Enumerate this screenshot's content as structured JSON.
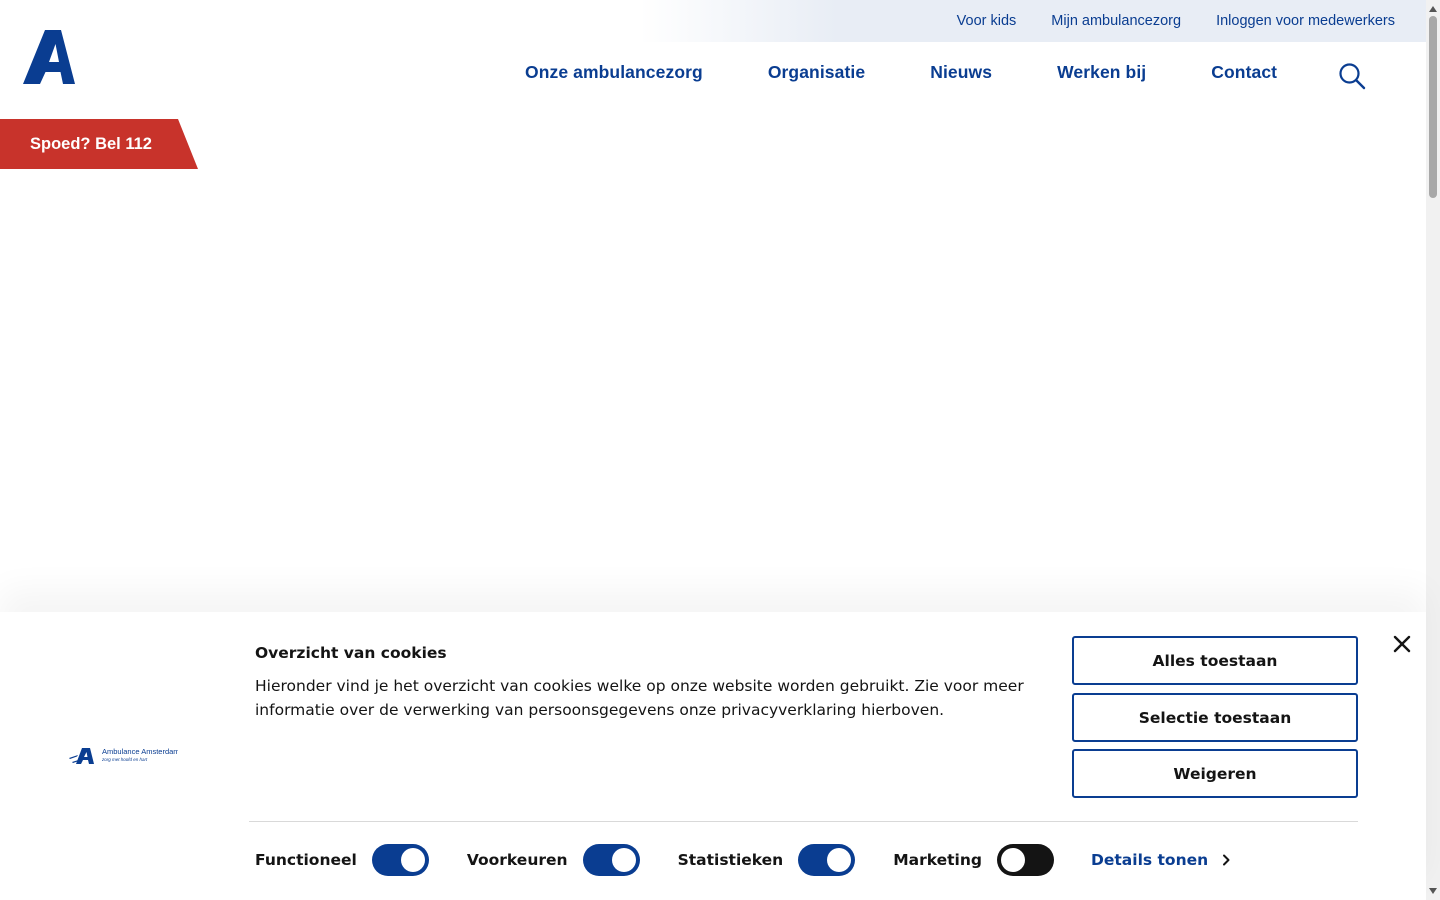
{
  "colors": {
    "brand_blue": "#0a3d91",
    "emergency_red": "#c8332b",
    "utility_bar_bg": "#e8edf5",
    "toggle_off": "#141414"
  },
  "utility_nav": {
    "items": [
      "Voor kids",
      "Mijn ambulancezorg",
      "Inloggen voor medewerkers"
    ]
  },
  "logo": {
    "alt": "A",
    "icon": "ambulance-amsterdam-a-logo"
  },
  "main_nav": {
    "items": [
      "Onze ambulancezorg",
      "Organisatie",
      "Nieuws",
      "Werken bij",
      "Contact"
    ],
    "search_icon": "search-icon"
  },
  "emergency": {
    "label": "Spoed? Bel 112"
  },
  "cookie_banner": {
    "logo_text": "Ambulance Amsterdam",
    "logo_tagline": "zorg met hoofd en hart",
    "title": "Overzicht van cookies",
    "body": "Hieronder vind je het overzicht van cookies welke op onze website worden gebruikt. Zie voor meer informatie over de verwerking van persoonsgegevens onze privacyverklaring hierboven.",
    "buttons": {
      "allow_all": "Alles toestaan",
      "allow_selection": "Selectie toestaan",
      "deny": "Weigeren"
    },
    "toggles": [
      {
        "label": "Functioneel",
        "on": true
      },
      {
        "label": "Voorkeuren",
        "on": true
      },
      {
        "label": "Statistieken",
        "on": true
      },
      {
        "label": "Marketing",
        "on": false
      }
    ],
    "details_link": "Details tonen",
    "close_icon": "close-icon"
  }
}
